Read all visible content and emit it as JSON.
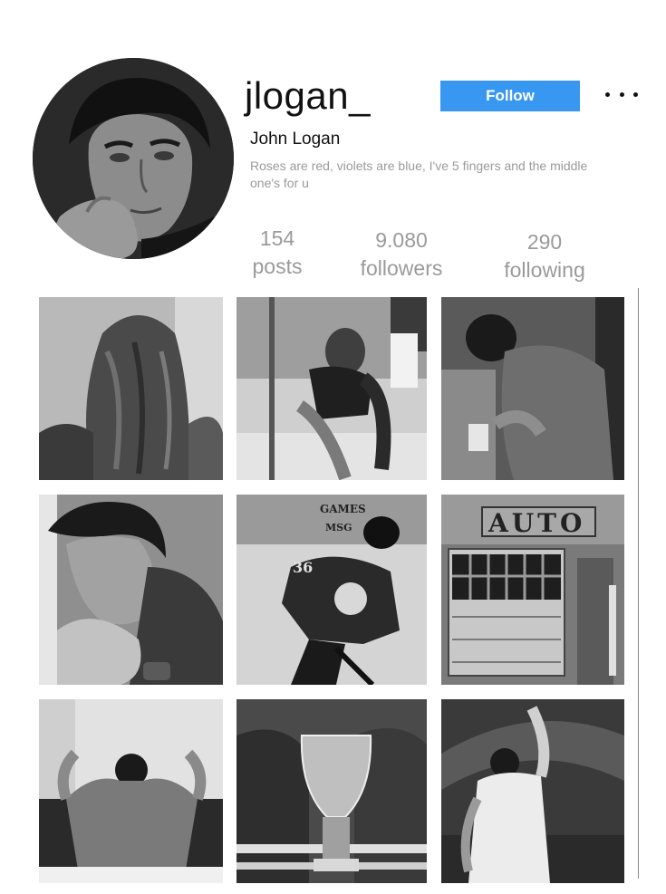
{
  "profile": {
    "username": "jlogan_",
    "full_name": "John Logan",
    "bio": "Roses are red, violets are blue, I've 5 fingers and the middle one's for u",
    "follow_label": "Follow",
    "more_icon": "ellipsis-icon"
  },
  "stats": {
    "posts": {
      "value": "154",
      "label": "posts"
    },
    "followers": {
      "value": "9.080",
      "label": "followers"
    },
    "following": {
      "value": "290",
      "label": "following"
    }
  },
  "grid": {
    "post_6_sign": "AUTO",
    "post_5_banner": "GAMES",
    "post_5_banner_2": "MSG",
    "post_5_jersey_number": "36"
  },
  "colors": {
    "accent": "#3897f0",
    "muted_text": "#9a9a9a"
  }
}
